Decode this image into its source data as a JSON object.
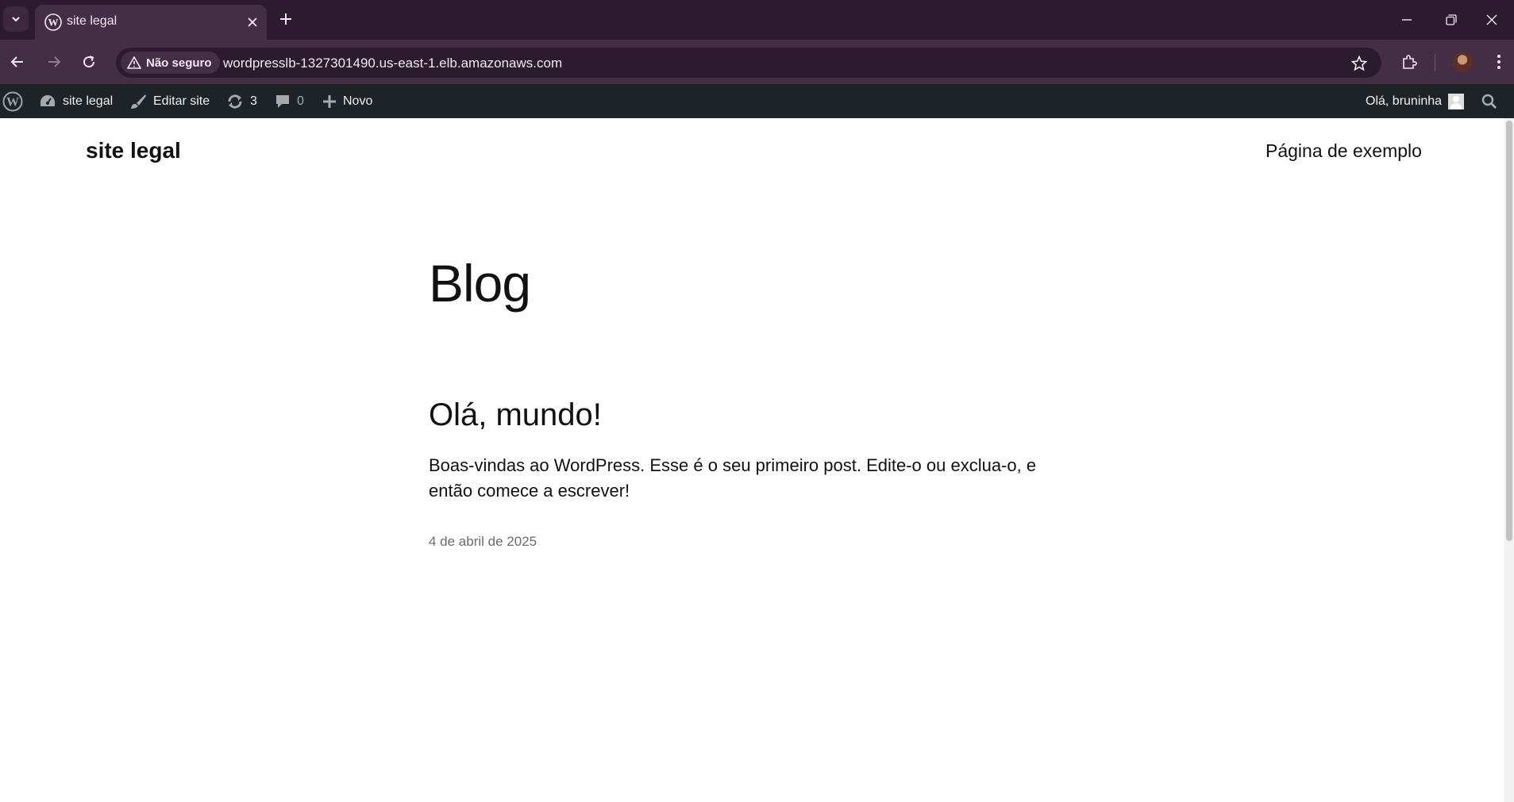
{
  "browser": {
    "tab": {
      "title": "site legal"
    },
    "address": {
      "security_label": "Não seguro",
      "url": "wordpresslb-1327301490.us-east-1.elb.amazonaws.com"
    },
    "icons": [
      "tab-list-icon",
      "wordpress-favicon",
      "close-icon",
      "plus-icon",
      "minimize-icon",
      "restore-icon",
      "window-close-icon",
      "back-arrow-icon",
      "forward-arrow-icon",
      "reload-icon",
      "warning-icon",
      "star-icon",
      "extensions-icon",
      "profile-avatar",
      "kebab-menu-icon"
    ]
  },
  "adminbar": {
    "site_name": "site legal",
    "edit_site": "Editar site",
    "updates_count": "3",
    "comments_count": "0",
    "new_label": "Novo",
    "greeting": "Olá, bruninha"
  },
  "site": {
    "title": "site legal",
    "nav_link": "Página de exemplo"
  },
  "main": {
    "heading": "Blog",
    "posts": [
      {
        "title": "Olá, mundo!",
        "excerpt": "Boas-vindas ao WordPress. Esse é o seu primeiro post. Edite-o ou exclua-o, e então comece a escrever!",
        "date": "4 de abril de 2025"
      }
    ]
  },
  "colors": {
    "tabstrip_bg": "#2c1b2e",
    "toolbar_bg": "#432e46",
    "adminbar_bg": "#1d2327",
    "page_bg": "#ffffff",
    "text": "#111111"
  }
}
